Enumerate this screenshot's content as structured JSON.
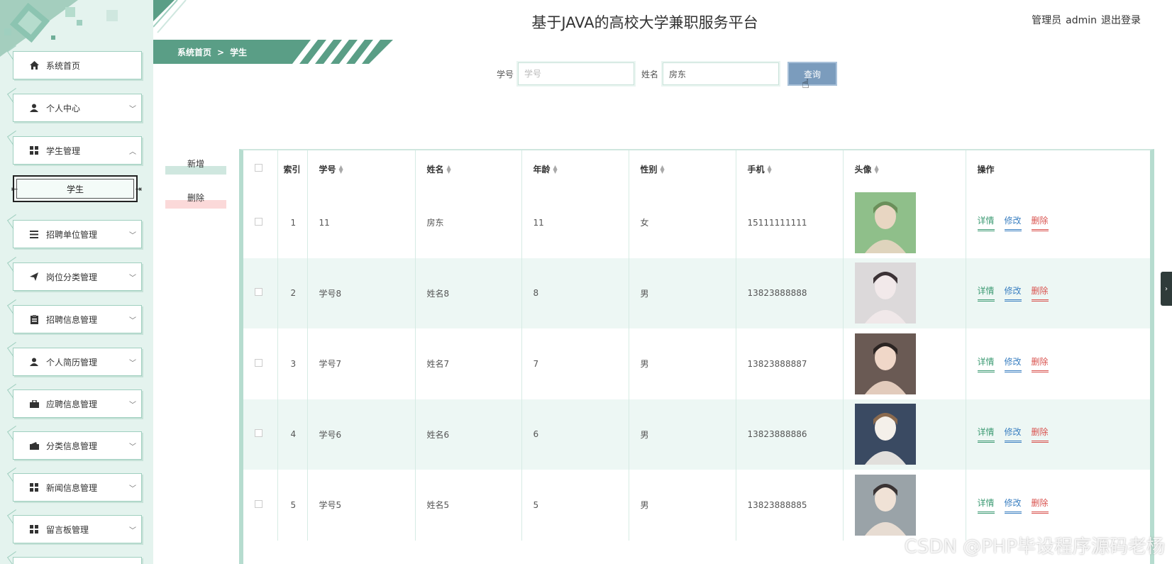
{
  "header": {
    "title": "基于JAVA的高校大学兼职服务平台",
    "user_role": "管理员",
    "user_name": "admin",
    "logout_label": "退出登录"
  },
  "breadcrumb": {
    "home": "系统首页",
    "separator": ">",
    "current": "学生"
  },
  "sidebar": {
    "items": [
      {
        "label": "系统首页",
        "icon": "home-icon"
      },
      {
        "label": "个人中心",
        "icon": "user-icon"
      },
      {
        "label": "学生管理",
        "icon": "grid-icon",
        "expanded": true
      },
      {
        "label": "招聘单位管理",
        "icon": "list-icon"
      },
      {
        "label": "岗位分类管理",
        "icon": "send-icon"
      },
      {
        "label": "招聘信息管理",
        "icon": "clipboard-icon"
      },
      {
        "label": "个人简历管理",
        "icon": "user-icon"
      },
      {
        "label": "应聘信息管理",
        "icon": "briefcase-icon"
      },
      {
        "label": "分类信息管理",
        "icon": "wallet-icon"
      },
      {
        "label": "新闻信息管理",
        "icon": "grid-icon"
      },
      {
        "label": "留言板管理",
        "icon": "grid-icon"
      }
    ],
    "subitem": "学生"
  },
  "search": {
    "student_id_label": "学号",
    "student_id_placeholder": "学号",
    "student_id_value": "",
    "name_label": "姓名",
    "name_value": "房东",
    "query_button": "查询"
  },
  "actions": {
    "add_label": "新增",
    "delete_label": "删除"
  },
  "table": {
    "columns": [
      "索引",
      "学号",
      "姓名",
      "年龄",
      "性别",
      "手机",
      "头像",
      "操作"
    ],
    "rows": [
      {
        "index": "1",
        "student_id": "11",
        "name": "房东",
        "age": "11",
        "gender": "女",
        "phone": "15111111111"
      },
      {
        "index": "2",
        "student_id": "学号8",
        "name": "姓名8",
        "age": "8",
        "gender": "男",
        "phone": "13823888888"
      },
      {
        "index": "3",
        "student_id": "学号7",
        "name": "姓名7",
        "age": "7",
        "gender": "男",
        "phone": "13823888887"
      },
      {
        "index": "4",
        "student_id": "学号6",
        "name": "姓名6",
        "age": "6",
        "gender": "男",
        "phone": "13823888886"
      },
      {
        "index": "5",
        "student_id": "学号5",
        "name": "姓名5",
        "age": "5",
        "gender": "男",
        "phone": "13823888885"
      }
    ],
    "op_detail": "详情",
    "op_edit": "修改",
    "op_delete": "删除"
  },
  "watermark": "CSDN @PHP毕设程序源码老杨",
  "colors": {
    "accent": "#5a9e86",
    "sidebar_bg": "#e4f3ee",
    "query_button": "#7b9cbd",
    "detail": "#3e9b74",
    "edit": "#3a7fc1",
    "delete": "#d9534f"
  }
}
